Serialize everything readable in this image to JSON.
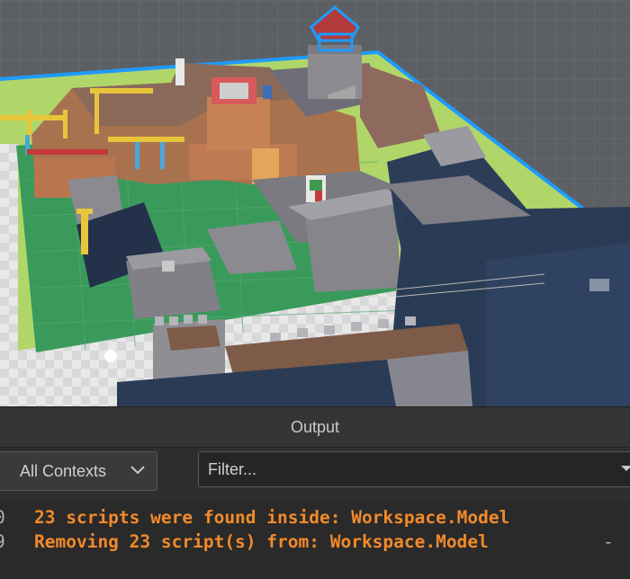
{
  "output": {
    "title": "Output",
    "contexts_label": "All Contexts",
    "filter_placeholder": "Filter...",
    "log": [
      {
        "timestamp_fragment": "0",
        "message": "23 scripts were found inside: Workspace.Model",
        "color": "#f28a2a"
      },
      {
        "timestamp_fragment": "9",
        "message": "Removing 23 script(s) from: Workspace.Model",
        "trailing": "-",
        "color": "#f28a2a"
      }
    ]
  },
  "colors": {
    "selection_outline": "#1e9bff",
    "warning_text": "#f28a2a",
    "panel_bg": "#2e2e2e",
    "baseplate_grass": "#b0d66a",
    "floor_green": "#3a9a5c",
    "wall_navy": "#2a3b55",
    "brick_orange": "#b8754e"
  },
  "icons": {
    "contexts_dropdown": "chevron-down-icon",
    "filter_dropdown": "caret-down-icon"
  }
}
